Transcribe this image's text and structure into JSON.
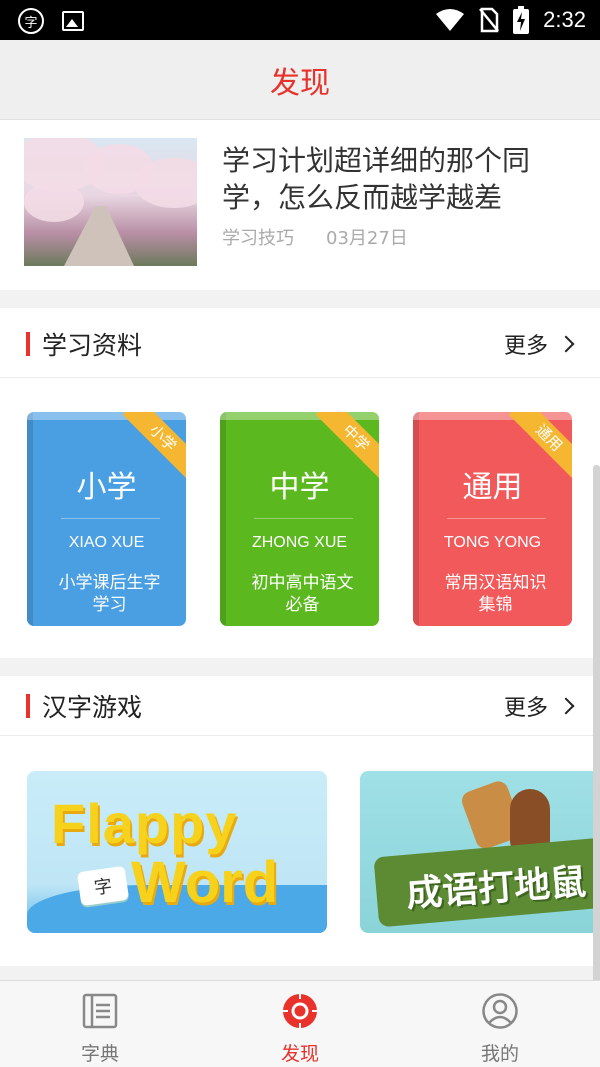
{
  "status_bar": {
    "app_glyph": "字",
    "time": "2:32"
  },
  "header": {
    "title": "发现"
  },
  "article": {
    "title": "学习计划超详细的那个同学，怎么反而越学越差",
    "category": "学习技巧",
    "date": "03月27日"
  },
  "materials": {
    "title": "学习资料",
    "more": "更多",
    "books": [
      {
        "name": "小学",
        "pinyin": "XIAO XUE",
        "desc_line1": "小学课后生字",
        "desc_line2": "学习",
        "ribbon": "小学",
        "color": "#4a9fe3"
      },
      {
        "name": "中学",
        "pinyin": "ZHONG XUE",
        "desc_line1": "初中高中语文",
        "desc_line2": "必备",
        "ribbon": "中学",
        "color": "#5bb81f"
      },
      {
        "name": "通用",
        "pinyin": "TONG YONG",
        "desc_line1": "常用汉语知识",
        "desc_line2": "集锦",
        "ribbon": "通用",
        "color": "#f2595b"
      }
    ]
  },
  "games": {
    "title": "汉字游戏",
    "more": "更多",
    "items": [
      {
        "line1": "Flappy",
        "line2": "Word",
        "tag": "字"
      },
      {
        "title": "成语打地鼠"
      }
    ]
  },
  "bottom_nav": [
    {
      "label": "字典",
      "icon": "book-icon"
    },
    {
      "label": "发现",
      "icon": "compass-target-icon",
      "active": true
    },
    {
      "label": "我的",
      "icon": "user-icon"
    }
  ],
  "colors": {
    "accent": "#e8322b",
    "ribbon": "#f5b731"
  }
}
